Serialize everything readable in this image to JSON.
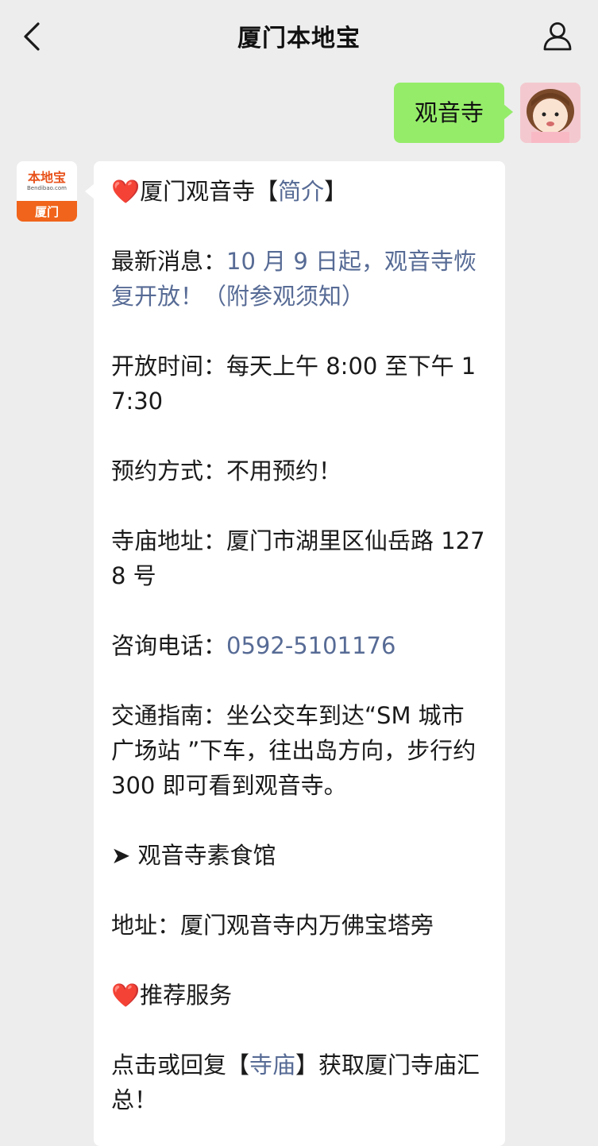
{
  "header": {
    "title": "厦门本地宝",
    "back_icon": "chevron-left-icon",
    "profile_icon": "person-icon"
  },
  "user_message": {
    "text": "观音寺"
  },
  "bot": {
    "logo_main": "本地宝",
    "logo_sub": "Bendibao.com",
    "logo_city": "厦门"
  },
  "reply": {
    "intro": {
      "emoji": "❤️",
      "prefix": "厦门观音寺【",
      "link": "简介",
      "suffix": "】"
    },
    "news": {
      "label": "最新消息：",
      "link": "10 月 9 日起，观音寺恢复开放！（附参观须知）"
    },
    "hours": {
      "label": "开放时间：",
      "value": "每天上午 8:00 至下午 17:30"
    },
    "booking": {
      "label": "预约方式：",
      "value": "不用预约！"
    },
    "address": {
      "label": "寺庙地址：",
      "value": "厦门市湖里区仙岳路 1278 号"
    },
    "phone": {
      "label": "咨询电话：",
      "link": "0592-5101176"
    },
    "transport": {
      "label": "交通指南：",
      "value": "坐公交车到达“SM 城市广场站 ”下车，往出岛方向，步行约 300 即可看到观音寺。"
    },
    "restaurant": {
      "arrow": "➤",
      "title": "观音寺素食馆"
    },
    "restaurant_address": {
      "label": "地址：",
      "value": "厦门观音寺内万佛宝塔旁"
    },
    "recommend": {
      "emoji": "❤️",
      "title": "推荐服务"
    },
    "cta": {
      "prefix": "点击或回复【",
      "link": "寺庙",
      "suffix": "】获取厦门寺庙汇总！"
    }
  },
  "colors": {
    "background": "#ededed",
    "user_bubble": "#95ec69",
    "link": "#576b95",
    "brand": "#f0641b"
  }
}
